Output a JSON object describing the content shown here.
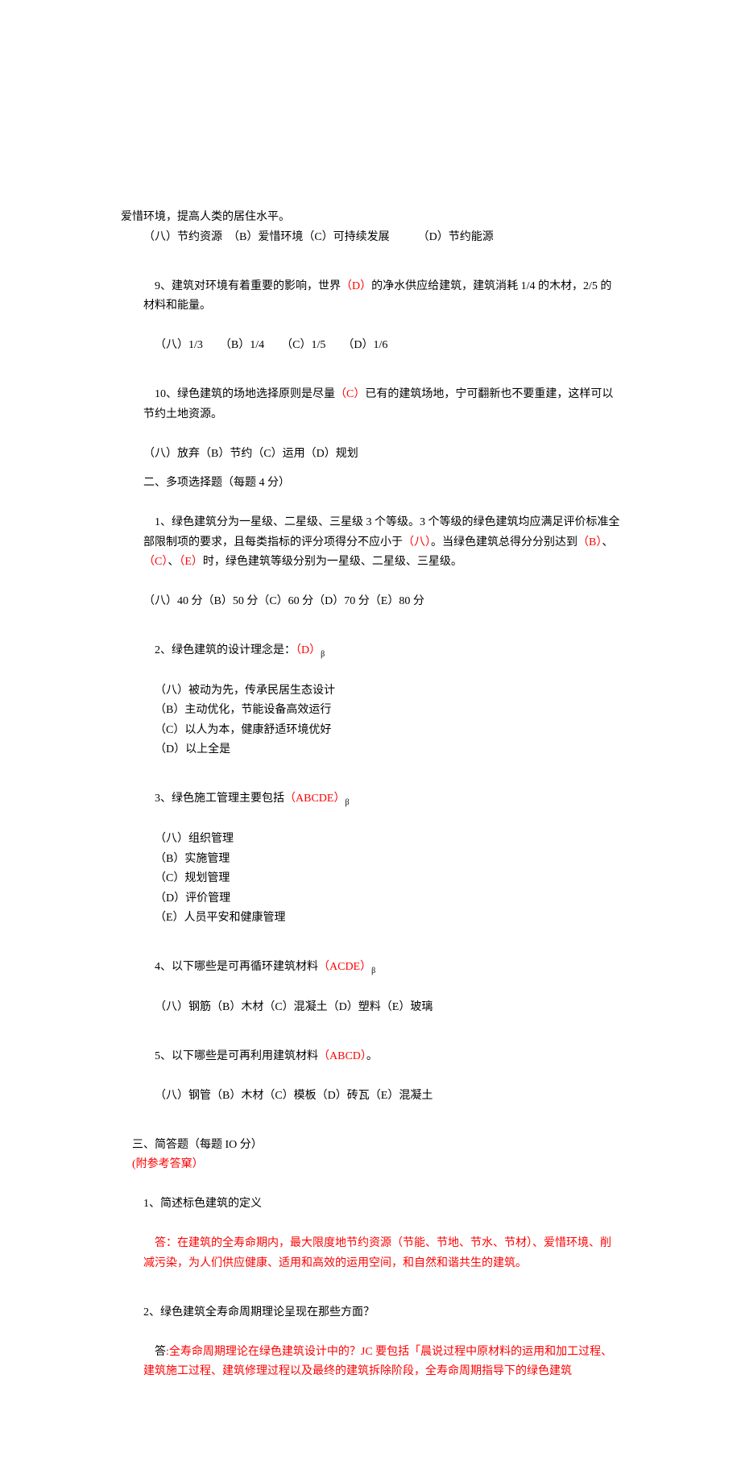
{
  "top_fragment": "爱惜环境，提高人类的居住水平。",
  "q8_choices": "（八）节约资源　（B）爱惜环境（C）可持续发展　　　（D）节约能源",
  "q9_pre": "9、建筑对环境有着重要的影响，世界",
  "q9_ans": "（D）",
  "q9_post": "的净水供应给建筑，建筑消耗 1/4 的木材，2/5 的材料和能量。",
  "q9_choices": "（八）1/3　　（B）1/4　　（C）1/5　　（D）1/6",
  "q10_pre": "10、绿色建筑的场地选择原则是尽量",
  "q10_ans": "（C）",
  "q10_post": "已有的建筑场地，宁可翻新也不要重建，这样可以节约土地资源。",
  "q10_choices": "（八）放弃（B）节约（C）运用（D）规划",
  "section2_title": "二、多项选择题（每题 4 分）",
  "m1_pre1": "1、绿色建筑分为一星级、二星级、三星级 3 个等级。3 个等级的绿色建筑均应满足评价标准全部限制项的要求，且每类指标的评分项得分不应小于",
  "m1_a1": "（八）",
  "m1_mid": "。当绿色建筑总得分分别达到",
  "m1_a2": "（B）",
  "m1_sep": "、",
  "m1_a3": "（C）",
  "m1_sep2": "、",
  "m1_a4": "（E）",
  "m1_post": "时，绿色建筑等级分别为一星级、二星级、三星级。",
  "m1_choices": "（八）40 分（B）50 分（C）60 分（D）70 分（E）80 分",
  "m2_stem_pre": "2、绿色建筑的设计理念是：",
  "m2_ans": "（D）",
  "m2_sub": "β",
  "m2_a": "（八）被动为先，传承民居生态设计",
  "m2_b": "（B）主动优化，节能设备高效运行",
  "m2_c": "（C）以人为本，健康舒适环境优好",
  "m2_d": "（D）以上全是",
  "m3_stem_pre": "3、绿色施工管理主要包括",
  "m3_ans": "（ABCDE）",
  "m3_sub": "β",
  "m3_a": "（八）组织管理",
  "m3_b": "（B）实施管理",
  "m3_c": "（C）规划管理",
  "m3_d": "（D）评价管理",
  "m3_e": "（E）人员平安和健康管理",
  "m4_stem_pre": "4、以下哪些是可再循环建筑材料",
  "m4_ans": "（ACDE）",
  "m4_sub": "β",
  "m4_choices": "（八）钢筋（B）木材（C）混凝土（D）塑料（E）玻璃",
  "m5_stem_pre": "5、以下哪些是可再利用建筑材料",
  "m5_ans": "（ABCD）",
  "m5_post": "。",
  "m5_choices": "（八）钢管（B）木材（C）模板（D）砖瓦（E）混凝土",
  "section3_pre": "三、简答题（每题 IO 分）",
  "section3_note": "(附参考答窠）",
  "s1_q": "1、简述标色建筑的定义",
  "s1_a_lbl": "答：",
  "s1_a_body": "在建筑的全寿命期内，最大限度地节约资源（节能、节地、节水、节材）、爱惜环境、削减污染，为人们供应健康、适用和高效的运用空间，和自然和谐共生的建筑。",
  "s2_q": "2、绿色建筑全寿命周期理论呈现在那些方面？",
  "s2_a_lbl": "答",
  "s2_colon": ":",
  "s2_a_body": "全寿命周期理论在绿色建筑设计中的？JC 要包括「晨说过程中原材料的运用和加工过程、建筑施工过程、建筑修理过程以及最终的建筑拆除阶段，全寿命周期指导下的绿色建筑"
}
